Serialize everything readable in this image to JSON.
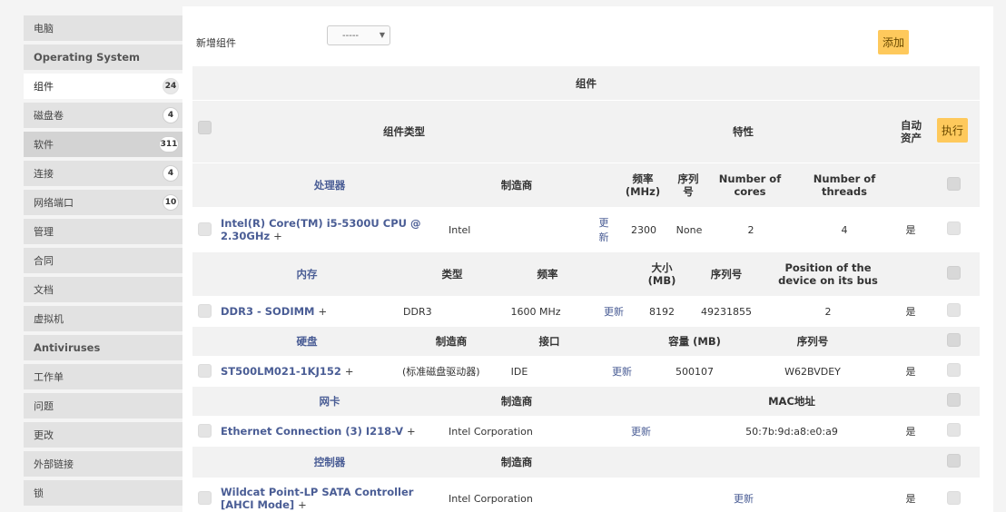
{
  "sidebar": {
    "items": [
      {
        "label": "电脑",
        "badge": ""
      },
      {
        "label": "Operating System",
        "badge": ""
      },
      {
        "label": "组件",
        "badge": "24"
      },
      {
        "label": "磁盘卷",
        "badge": "4"
      },
      {
        "label": "软件",
        "badge": "311"
      },
      {
        "label": "连接",
        "badge": "4"
      },
      {
        "label": "网络端口",
        "badge": "10"
      },
      {
        "label": "管理",
        "badge": ""
      },
      {
        "label": "合同",
        "badge": ""
      },
      {
        "label": "文档",
        "badge": ""
      },
      {
        "label": "虚拟机",
        "badge": ""
      },
      {
        "label": "Antiviruses",
        "badge": ""
      },
      {
        "label": "工作单",
        "badge": ""
      },
      {
        "label": "问题",
        "badge": ""
      },
      {
        "label": "更改",
        "badge": ""
      },
      {
        "label": "外部链接",
        "badge": ""
      },
      {
        "label": "锁",
        "badge": ""
      }
    ]
  },
  "add_component": {
    "label": "新增组件",
    "select_value": "-----",
    "add_button": "添加"
  },
  "table": {
    "title": "组件",
    "header": {
      "type": "组件类型",
      "properties": "特性",
      "auto_asset": "自动资产",
      "execute_button": "执行"
    },
    "processor": {
      "headers": [
        "处理器",
        "制造商",
        "频率 (MHz)",
        "序列号",
        "Number of cores",
        "Number of threads"
      ],
      "row": {
        "name": "Intel(R) Core(TM) i5-5300U CPU @ 2.30GHz",
        "plus": "+",
        "manufacturer": "Intel",
        "update": "更新",
        "frequency": "2300",
        "serial": "None",
        "cores": "2",
        "threads": "4",
        "auto": "是"
      }
    },
    "memory": {
      "headers": [
        "内存",
        "类型",
        "频率",
        "大小 (MB)",
        "序列号",
        "Position of the device on its bus"
      ],
      "row": {
        "name": "DDR3 - SODIMM",
        "plus": "+",
        "type": "DDR3",
        "frequency": "1600 MHz",
        "update": "更新",
        "size": "8192",
        "serial": "49231855",
        "position": "2",
        "auto": "是"
      }
    },
    "harddrive": {
      "headers": [
        "硬盘",
        "制造商",
        "接口",
        "容量 (MB)",
        "序列号"
      ],
      "row": {
        "name": "ST500LM021-1KJ152",
        "plus": "+",
        "manufacturer": "(标准磁盘驱动器)",
        "interface": "IDE",
        "update": "更新",
        "capacity": "500107",
        "serial": "W62BVDEY",
        "auto": "是"
      }
    },
    "network": {
      "headers": [
        "网卡",
        "制造商",
        "MAC地址"
      ],
      "row": {
        "name": "Ethernet Connection (3) I218-V",
        "plus": "+",
        "manufacturer": "Intel Corporation",
        "update": "更新",
        "mac": "50:7b:9d:a8:e0:a9",
        "auto": "是"
      }
    },
    "controller": {
      "headers": [
        "控制器",
        "制造商"
      ],
      "row": {
        "name": "Wildcat Point-LP SATA Controller [AHCI Mode]",
        "plus": "+",
        "manufacturer": "Intel Corporation",
        "update": "更新",
        "auto": "是"
      }
    }
  }
}
